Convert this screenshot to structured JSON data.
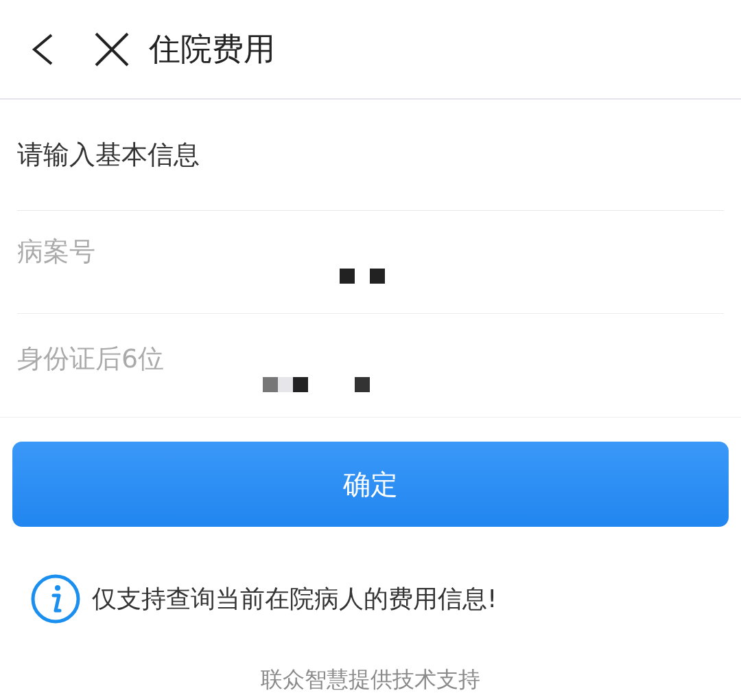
{
  "header": {
    "title": "住院费用"
  },
  "form": {
    "heading": "请输入基本信息",
    "fields": [
      {
        "label": "病案号",
        "redacted": true
      },
      {
        "label": "身份证后6位",
        "redacted": true
      }
    ]
  },
  "submit": {
    "label": "确定"
  },
  "notice": {
    "text": "仅支持查询当前在院病人的费用信息!"
  },
  "footer": {
    "text": "联众智慧提供技术支持"
  }
}
